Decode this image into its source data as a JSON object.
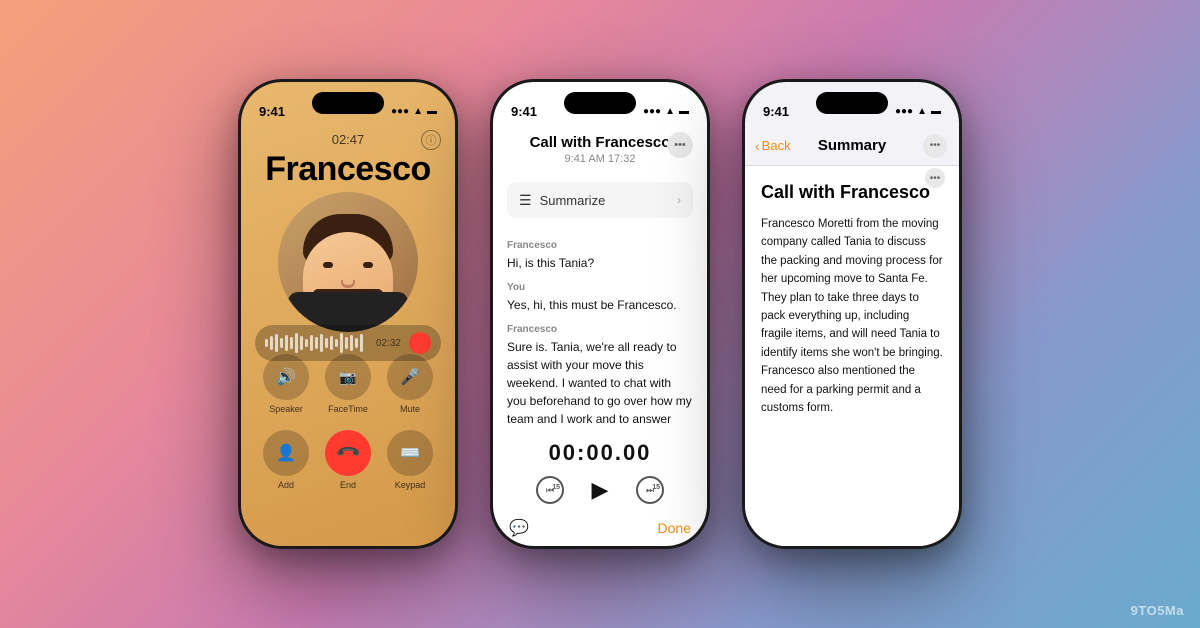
{
  "watermark": "9TO5Ma",
  "phone1": {
    "status_time": "9:41",
    "call_duration_top": "02:47",
    "caller_name": "Francesco",
    "wave_time": "02:32",
    "controls": {
      "row1": [
        {
          "icon": "🔊",
          "label": "Speaker"
        },
        {
          "icon": "📷",
          "label": "FaceTime"
        },
        {
          "icon": "🎤",
          "label": "Mute"
        }
      ],
      "row2": [
        {
          "icon": "👤",
          "label": "Add"
        },
        {
          "icon": "📞",
          "label": "End",
          "red": true
        },
        {
          "icon": "⌨️",
          "label": "Keypad"
        }
      ]
    }
  },
  "phone2": {
    "status_time": "9:41",
    "title": "Call with Francesco",
    "subtitle": "9:41 AM  17:32",
    "summarize_label": "Summarize",
    "transcript": [
      {
        "speaker": "Francesco",
        "text": "Hi, is this Tania?"
      },
      {
        "speaker": "You",
        "text": "Yes, hi, this must be Francesco."
      },
      {
        "speaker": "Francesco",
        "text": "Sure is. Tania, we're all ready to assist with your move this weekend. I wanted to chat with you beforehand to go over how my team and I work and to answer any questions you might have before we arrive Saturday"
      }
    ],
    "playback_time": "00:00.00",
    "done_label": "Done"
  },
  "phone3": {
    "status_time": "9:41",
    "nav_back": "Back",
    "nav_title": "Summary",
    "call_title": "Call with Francesco",
    "summary_text": "Francesco Moretti from the moving company called Tania to discuss the packing and moving process for her upcoming move to Santa Fe. They plan to take three days to pack everything up, including fragile items, and will need Tania to identify items she won't be bringing. Francesco also mentioned the need for a parking permit and a customs form."
  }
}
